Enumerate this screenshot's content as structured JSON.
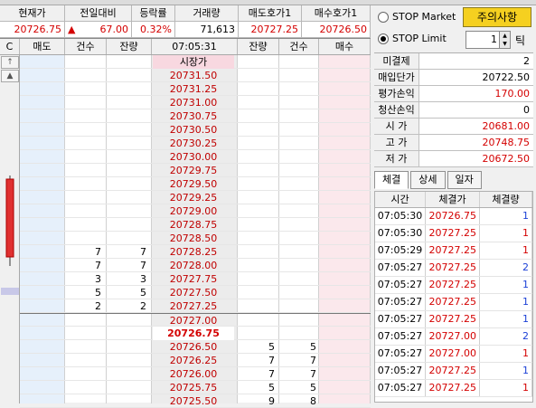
{
  "header": {
    "labels": [
      "현재가",
      "전일대비",
      "등락률",
      "거래량",
      "매도호가1",
      "매수호가1"
    ],
    "current_price": "20726.75",
    "change_arrow": "▲",
    "change": "67.00",
    "change_rate": "0.32%",
    "volume": "71,613",
    "ask1": "20727.25",
    "bid1": "20726.50"
  },
  "book": {
    "columns": [
      "매도",
      "건수",
      "잔량",
      "07:05:31",
      "잔량",
      "건수",
      "매수"
    ],
    "side_buttons": [
      "C",
      "↑",
      "▲"
    ],
    "open_label": "시장가",
    "current_price": "20726.75",
    "asks": [
      {
        "price": "20731.50",
        "cnt": "",
        "qty": ""
      },
      {
        "price": "20731.25",
        "cnt": "",
        "qty": ""
      },
      {
        "price": "20731.00",
        "cnt": "",
        "qty": ""
      },
      {
        "price": "20730.75",
        "cnt": "",
        "qty": ""
      },
      {
        "price": "20730.50",
        "cnt": "",
        "qty": ""
      },
      {
        "price": "20730.25",
        "cnt": "",
        "qty": ""
      },
      {
        "price": "20730.00",
        "cnt": "",
        "qty": ""
      },
      {
        "price": "20729.75",
        "cnt": "",
        "qty": ""
      },
      {
        "price": "20729.50",
        "cnt": "",
        "qty": ""
      },
      {
        "price": "20729.25",
        "cnt": "",
        "qty": ""
      },
      {
        "price": "20729.00",
        "cnt": "",
        "qty": ""
      },
      {
        "price": "20728.75",
        "cnt": "",
        "qty": ""
      },
      {
        "price": "20728.50",
        "cnt": "",
        "qty": ""
      },
      {
        "price": "20728.25",
        "cnt": "7",
        "qty": "7"
      },
      {
        "price": "20728.00",
        "cnt": "7",
        "qty": "7"
      },
      {
        "price": "20727.75",
        "cnt": "3",
        "qty": "3"
      },
      {
        "price": "20727.50",
        "cnt": "5",
        "qty": "5"
      },
      {
        "price": "20727.25",
        "cnt": "2",
        "qty": "2"
      },
      {
        "price": "20727.00",
        "cnt": "",
        "qty": ""
      }
    ],
    "bids": [
      {
        "price": "20726.50",
        "cnt": "5",
        "qty": "5"
      },
      {
        "price": "20726.25",
        "cnt": "7",
        "qty": "7"
      },
      {
        "price": "20726.00",
        "cnt": "7",
        "qty": "7"
      },
      {
        "price": "20725.75",
        "cnt": "5",
        "qty": "5"
      },
      {
        "price": "20725.50",
        "cnt": "8",
        "qty": "9"
      }
    ]
  },
  "right_panel": {
    "stop_market": "STOP Market",
    "stop_limit": "STOP Limit",
    "warning_button": "주의사항",
    "tick_value": "1",
    "tick_label": "틱",
    "position": [
      {
        "k": "미결제",
        "v": "2"
      },
      {
        "k": "매입단가",
        "v": "20722.50"
      },
      {
        "k": "평가손익",
        "v": "170.00"
      },
      {
        "k": "청산손익",
        "v": "0"
      }
    ],
    "ohl": [
      {
        "k": "시 가",
        "v": "20681.00"
      },
      {
        "k": "고 가",
        "v": "20748.75"
      },
      {
        "k": "저 가",
        "v": "20672.50"
      }
    ],
    "tabs": [
      "체결",
      "상세",
      "일자"
    ],
    "trade_headers": [
      "시간",
      "체결가",
      "체결량"
    ],
    "trades": [
      {
        "t": "07:05:30",
        "p": "20726.75",
        "q": "1",
        "c": "blue"
      },
      {
        "t": "07:05:30",
        "p": "20727.25",
        "q": "1",
        "c": "red"
      },
      {
        "t": "07:05:29",
        "p": "20727.25",
        "q": "1",
        "c": "red"
      },
      {
        "t": "07:05:27",
        "p": "20727.25",
        "q": "2",
        "c": "blue"
      },
      {
        "t": "07:05:27",
        "p": "20727.25",
        "q": "1",
        "c": "blue"
      },
      {
        "t": "07:05:27",
        "p": "20727.25",
        "q": "1",
        "c": "blue"
      },
      {
        "t": "07:05:27",
        "p": "20727.25",
        "q": "1",
        "c": "blue"
      },
      {
        "t": "07:05:27",
        "p": "20727.00",
        "q": "2",
        "c": "blue"
      },
      {
        "t": "07:05:27",
        "p": "20727.00",
        "q": "1",
        "c": "red"
      },
      {
        "t": "07:05:27",
        "p": "20727.25",
        "q": "1",
        "c": "blue"
      },
      {
        "t": "07:05:27",
        "p": "20727.25",
        "q": "1",
        "c": "red"
      }
    ]
  }
}
